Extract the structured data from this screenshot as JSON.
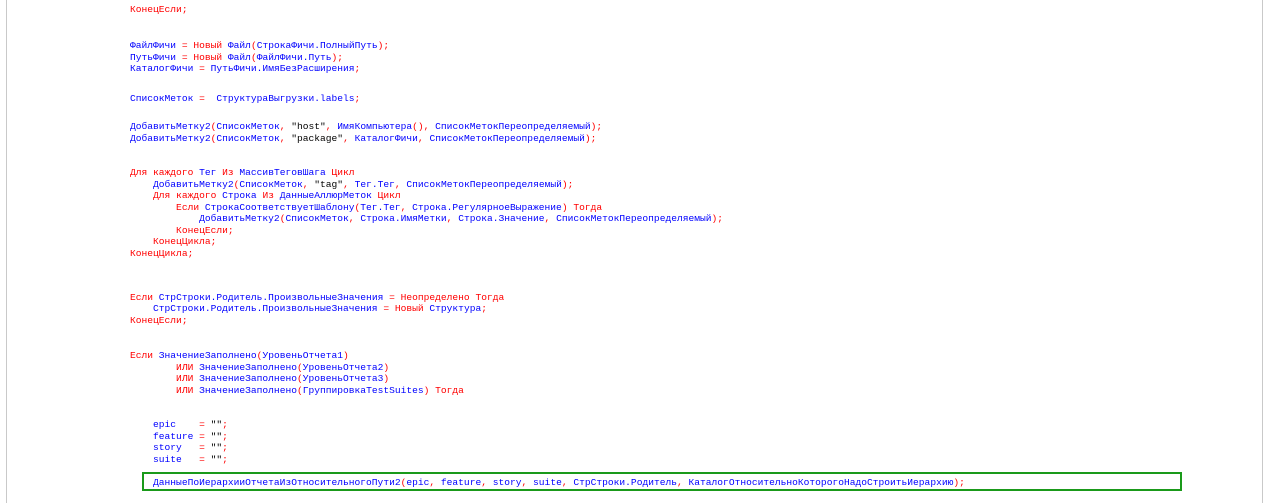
{
  "colors": {
    "keyword": "#ff0000",
    "identifier": "#0000ff",
    "string": "#000000",
    "highlight_border": "#1a9a1a"
  },
  "code_lines": [
    [
      [
        "kw",
        "КонецЕсли;"
      ]
    ],
    [],
    [
      [
        "id",
        "    "
      ],
      [
        "id",
        "ФайлФичи "
      ],
      [
        "kw",
        "= Новый"
      ],
      [
        "id",
        " Файл"
      ],
      [
        "kw",
        "("
      ],
      [
        "id",
        "СтрокаФичи.ПолныйПуть"
      ],
      [
        "kw",
        ");"
      ]
    ],
    [
      [
        "id",
        "ПутьФичи "
      ],
      [
        "kw",
        "= Новый"
      ],
      [
        "id",
        " Файл"
      ],
      [
        "kw",
        "("
      ],
      [
        "id",
        "ФайлФичи.Путь"
      ],
      [
        "kw",
        ");"
      ]
    ],
    [
      [
        "id",
        "КаталогФичи "
      ],
      [
        "kw",
        "="
      ],
      [
        "id",
        " ПутьФичи.ИмяБезРасширения"
      ],
      [
        "kw",
        ";"
      ]
    ],
    [],
    [
      [
        "id",
        "СписокМеток "
      ],
      [
        "kw",
        "="
      ],
      [
        "id",
        "  СтруктураВыгрузки.labels"
      ],
      [
        "kw",
        ";"
      ]
    ],
    [],
    [
      [
        "id",
        "ДобавитьМетку2"
      ],
      [
        "kw",
        "("
      ],
      [
        "id",
        "СписокМеток"
      ],
      [
        "kw",
        ", "
      ],
      [
        "str",
        "\"host\""
      ],
      [
        "kw",
        ", "
      ],
      [
        "id",
        "ИмяКомпьютера"
      ],
      [
        "kw",
        "(), "
      ],
      [
        "id",
        "СписокМетокПереопределяемый"
      ],
      [
        "kw",
        ");"
      ]
    ],
    [
      [
        "id",
        "ДобавитьМетку2"
      ],
      [
        "kw",
        "("
      ],
      [
        "id",
        "СписокМеток"
      ],
      [
        "kw",
        ", "
      ],
      [
        "str",
        "\"package\""
      ],
      [
        "kw",
        ", "
      ],
      [
        "id",
        "КаталогФичи"
      ],
      [
        "kw",
        ", "
      ],
      [
        "id",
        "СписокМетокПереопределяемый"
      ],
      [
        "kw",
        ");"
      ]
    ],
    [],
    [
      [
        "kw",
        "Для каждого "
      ],
      [
        "id",
        "Тег "
      ],
      [
        "kw",
        "Из "
      ],
      [
        "id",
        "МассивТеговШага "
      ],
      [
        "kw",
        "Цикл"
      ]
    ],
    [
      [
        "id",
        "    ДобавитьМетку2"
      ],
      [
        "kw",
        "("
      ],
      [
        "id",
        "СписокМеток"
      ],
      [
        "kw",
        ", "
      ],
      [
        "str",
        "\"tag\""
      ],
      [
        "kw",
        ", "
      ],
      [
        "id",
        "Тег.Тег"
      ],
      [
        "kw",
        ", "
      ],
      [
        "id",
        "СписокМетокПереопределяемый"
      ],
      [
        "kw",
        ");"
      ]
    ],
    [
      [
        "kw",
        "    Для каждого "
      ],
      [
        "id",
        "Строка "
      ],
      [
        "kw",
        "Из "
      ],
      [
        "id",
        "ДанныеАллюрМеток "
      ],
      [
        "kw",
        "Цикл"
      ]
    ],
    [
      [
        "kw",
        "        Если "
      ],
      [
        "id",
        "СтрокаСоответствуетШаблону"
      ],
      [
        "kw",
        "("
      ],
      [
        "id",
        "Тег.Тег"
      ],
      [
        "kw",
        ", "
      ],
      [
        "id",
        "Строка.РегулярноеВыражение"
      ],
      [
        "kw",
        ") Тогда"
      ]
    ],
    [
      [
        "id",
        "            ДобавитьМетку2"
      ],
      [
        "kw",
        "("
      ],
      [
        "id",
        "СписокМеток"
      ],
      [
        "kw",
        ", "
      ],
      [
        "id",
        "Строка.ИмяМетки"
      ],
      [
        "kw",
        ", "
      ],
      [
        "id",
        "Строка.Значение"
      ],
      [
        "kw",
        ", "
      ],
      [
        "id",
        "СписокМетокПереопределяемый"
      ],
      [
        "kw",
        ");"
      ]
    ],
    [
      [
        "kw",
        "        КонецЕсли;"
      ]
    ],
    [
      [
        "kw",
        "    КонецЦикла;"
      ]
    ],
    [
      [
        "kw",
        "КонецЦикла;"
      ]
    ],
    [],
    [
      [
        "kw",
        "Если "
      ],
      [
        "id",
        "СтрСтроки.Родитель.ПроизвольныеЗначения "
      ],
      [
        "kw",
        "= Неопределено Тогда"
      ]
    ],
    [
      [
        "id",
        "    СтрСтроки.Родитель.ПроизвольныеЗначения "
      ],
      [
        "kw",
        "= Новый"
      ],
      [
        "id",
        " Структура"
      ],
      [
        "kw",
        ";"
      ]
    ],
    [
      [
        "kw",
        "КонецЕсли;"
      ]
    ],
    [],
    [
      [
        "kw",
        "Если "
      ],
      [
        "id",
        "ЗначениеЗаполнено"
      ],
      [
        "kw",
        "("
      ],
      [
        "id",
        "УровеньОтчета1"
      ],
      [
        "kw",
        ")"
      ]
    ],
    [
      [
        "kw",
        "        ИЛИ "
      ],
      [
        "id",
        "ЗначениеЗаполнено"
      ],
      [
        "kw",
        "("
      ],
      [
        "id",
        "УровеньОтчета2"
      ],
      [
        "kw",
        ")"
      ]
    ],
    [
      [
        "kw",
        "        ИЛИ "
      ],
      [
        "id",
        "ЗначениеЗаполнено"
      ],
      [
        "kw",
        "("
      ],
      [
        "id",
        "УровеньОтчета3"
      ],
      [
        "kw",
        ")"
      ]
    ],
    [
      [
        "kw",
        "        ИЛИ "
      ],
      [
        "id",
        "ЗначениеЗаполнено"
      ],
      [
        "kw",
        "("
      ],
      [
        "id",
        "ГруппировкаTestSuites"
      ],
      [
        "kw",
        ") Тогда"
      ]
    ],
    [],
    [
      [
        "id",
        "    epic    "
      ],
      [
        "kw",
        "= "
      ],
      [
        "str",
        "\"\""
      ],
      [
        "kw",
        ";"
      ]
    ],
    [
      [
        "id",
        "    feature "
      ],
      [
        "kw",
        "= "
      ],
      [
        "str",
        "\"\""
      ],
      [
        "kw",
        ";"
      ]
    ],
    [
      [
        "id",
        "    story   "
      ],
      [
        "kw",
        "= "
      ],
      [
        "str",
        "\"\""
      ],
      [
        "kw",
        ";"
      ]
    ],
    [
      [
        "id",
        "    suite   "
      ],
      [
        "kw",
        "= "
      ],
      [
        "str",
        "\"\""
      ],
      [
        "kw",
        ";"
      ]
    ],
    [
      [
        "id",
        "    ДанныеПоИерархииОтчетаИзОтносительногоПути2"
      ],
      [
        "kw",
        "("
      ],
      [
        "id",
        "epic"
      ],
      [
        "kw",
        ", "
      ],
      [
        "id",
        "feature"
      ],
      [
        "kw",
        ", "
      ],
      [
        "id",
        "story"
      ],
      [
        "kw",
        ", "
      ],
      [
        "id",
        "suite"
      ],
      [
        "kw",
        ", "
      ],
      [
        "id",
        "СтрСтроки.Родитель"
      ],
      [
        "kw",
        ", "
      ],
      [
        "id",
        "КаталогОтносительноКоторогоНадоСтроитьИерархию"
      ],
      [
        "kw",
        ");"
      ]
    ]
  ]
}
